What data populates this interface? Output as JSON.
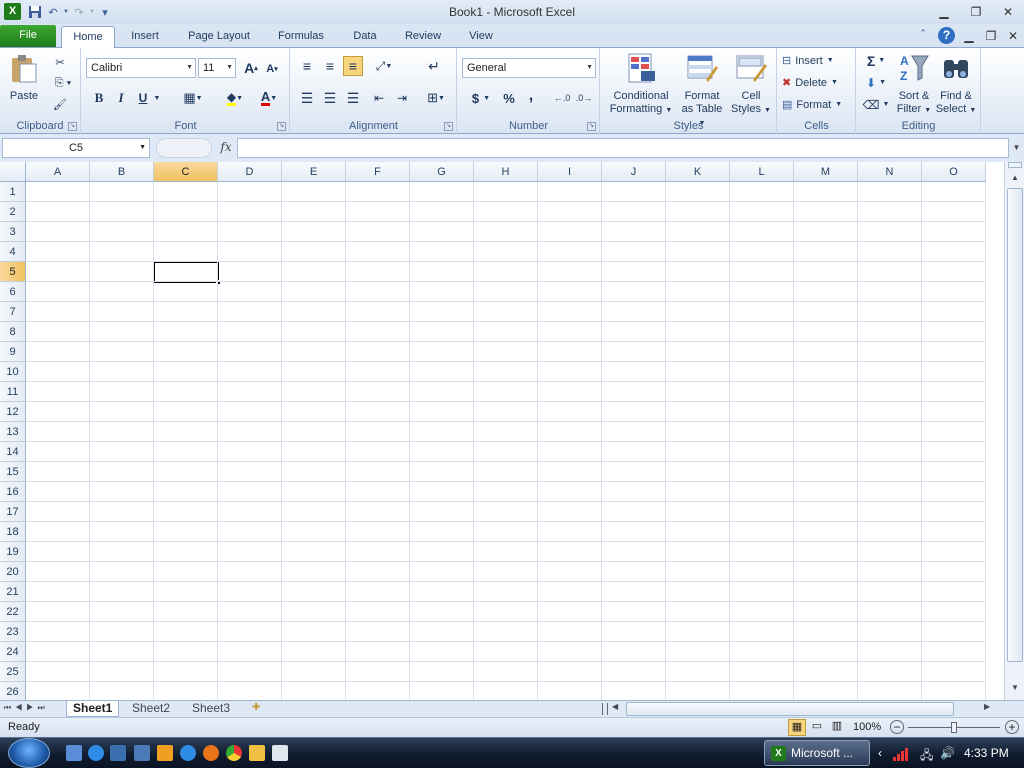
{
  "window": {
    "title": "Book1 - Microsoft Excel",
    "qat": {
      "save_icon": "save-icon",
      "undo_icon": "undo-icon",
      "redo_icon": "redo-icon",
      "customize_icon": "customize-qat-icon"
    }
  },
  "tabs": [
    {
      "label": "File"
    },
    {
      "label": "Home"
    },
    {
      "label": "Insert"
    },
    {
      "label": "Page Layout"
    },
    {
      "label": "Formulas"
    },
    {
      "label": "Data"
    },
    {
      "label": "Review"
    },
    {
      "label": "View"
    }
  ],
  "ribbon": {
    "clipboard": {
      "label": "Clipboard",
      "paste": "Paste"
    },
    "font": {
      "label": "Font",
      "name": "Calibri",
      "size": "11",
      "bold": "B",
      "italic": "I",
      "underline": "U",
      "grow": "A",
      "shrink": "A",
      "font_color_letter": "A"
    },
    "alignment": {
      "label": "Alignment"
    },
    "number": {
      "label": "Number",
      "format": "General",
      "currency": "$",
      "percent": "%",
      "comma": ","
    },
    "styles": {
      "label": "Styles",
      "conditional": "Conditional",
      "conditional2": "Formatting",
      "format_table": "Format",
      "format_table2": "as Table",
      "cell_styles": "Cell",
      "cell_styles2": "Styles"
    },
    "cells": {
      "label": "Cells",
      "insert": "Insert",
      "delete": "Delete",
      "format": "Format"
    },
    "editing": {
      "label": "Editing",
      "sort": "Sort &",
      "sort2": "Filter",
      "find": "Find &",
      "find2": "Select",
      "sum": "Σ"
    }
  },
  "formula_bar": {
    "name_box": "C5",
    "fx": "fx",
    "value": ""
  },
  "grid": {
    "columns": [
      "A",
      "B",
      "C",
      "D",
      "E",
      "F",
      "G",
      "H",
      "I",
      "J",
      "K",
      "L",
      "M",
      "N",
      "O"
    ],
    "rows": [
      "1",
      "2",
      "3",
      "4",
      "5",
      "6",
      "7",
      "8",
      "9",
      "10",
      "11",
      "12",
      "13",
      "14",
      "15",
      "16",
      "17",
      "18",
      "19",
      "20",
      "21",
      "22",
      "23",
      "24",
      "25",
      "26"
    ],
    "selected_column": "C",
    "selected_row": "5"
  },
  "sheets": [
    {
      "label": "Sheet1",
      "active": true
    },
    {
      "label": "Sheet2"
    },
    {
      "label": "Sheet3"
    }
  ],
  "status": {
    "ready": "Ready",
    "zoom": "100%",
    "zoom_out": "−",
    "zoom_in": "+"
  },
  "taskbar": {
    "app_button": "Microsoft ...",
    "time": "4:33 PM"
  }
}
